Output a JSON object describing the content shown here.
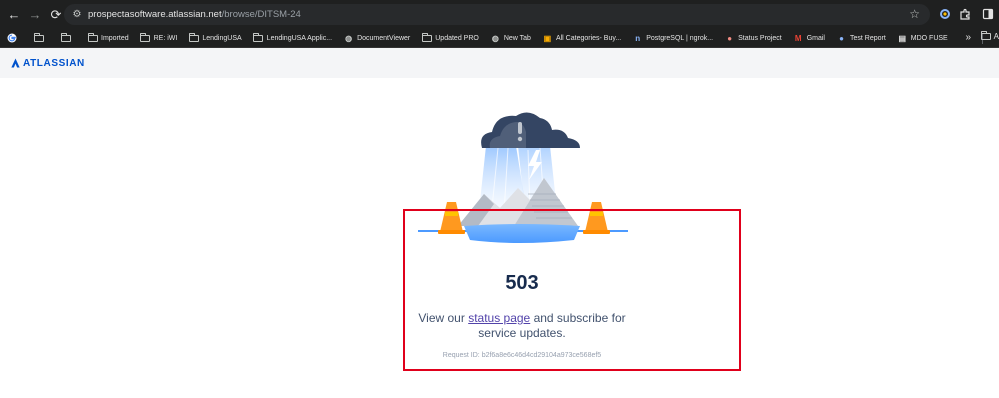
{
  "browser": {
    "url_host": "prospectasoftware.atlassian.net",
    "url_path": "/browse/DITSM-24",
    "bookmarks": [
      {
        "label": "",
        "icon": "google-icon"
      },
      {
        "label": "",
        "icon": "folder-icon"
      },
      {
        "label": "",
        "icon": "folder-icon"
      },
      {
        "label": "Imported",
        "icon": "folder-icon"
      },
      {
        "label": "RE: iWI",
        "icon": "folder-icon"
      },
      {
        "label": "LendingUSA",
        "icon": "folder-icon"
      },
      {
        "label": "LendingUSA Applic...",
        "icon": "folder-icon"
      },
      {
        "label": "DocumentViewer",
        "icon": "globe-icon"
      },
      {
        "label": "Updated PRO",
        "icon": "folder-icon"
      },
      {
        "label": "New Tab",
        "icon": "globe-icon"
      },
      {
        "label": "All Categories- Buy...",
        "icon": "store-icon"
      },
      {
        "label": "PostgreSQL | ngrok...",
        "icon": "ngrok-icon"
      },
      {
        "label": "Status Project",
        "icon": "status-icon"
      },
      {
        "label": "Gmail",
        "icon": "gmail-icon"
      },
      {
        "label": "Test Report",
        "icon": "report-icon"
      },
      {
        "label": "MDO FUSE",
        "icon": "fuse-icon"
      }
    ],
    "bookmarks_overflow": "»",
    "bookmarks_last": "A"
  },
  "header": {
    "brand": "ATLASSIAN"
  },
  "error": {
    "code": "503",
    "message_before": "View our ",
    "link_text": "status page",
    "message_after": " and subscribe for service updates.",
    "request_id": "Request ID: b2f6a8e6c46d4cd29104a973ce568ef5"
  },
  "colors": {
    "brand_blue": "#0052cc",
    "highlight_red": "#e0001b",
    "heading": "#172b4d",
    "body_text": "#42526e"
  }
}
